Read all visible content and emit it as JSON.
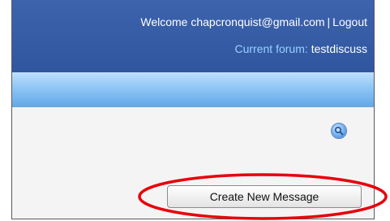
{
  "header": {
    "welcome_text": "Welcome chapcronquist@gmail.com",
    "separator": "|",
    "logout_label": "Logout",
    "forum_label": "Current forum:",
    "forum_name": "testdiscuss"
  },
  "toolbar": {
    "search_icon": "search-icon",
    "create_button_label": "Create New Message"
  },
  "colors": {
    "header_bg": "#2f569f",
    "band_bg": "#8fc6f5",
    "highlight": "#e8000b"
  }
}
